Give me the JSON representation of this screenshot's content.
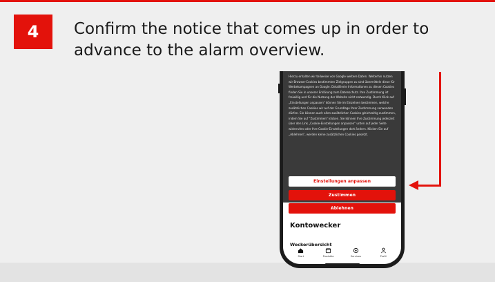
{
  "step": {
    "number": "4"
  },
  "instruction": "Confirm the notice that comes up in order to advance to the alarm overview.",
  "phone": {
    "cookie_text": "Hierzu erhalten wir teilweise von Google weitere Daten. Weiterhin nutzen wir Browser-Cookies bestimmten Zielgruppen zu sind übermitteln diese für Werbekampagnen an Google. Detaillierte Informationen zu diesen Cookies finden Sie in unserer Erklärung zum Datenschutz. Ihre Zustimmung ist freiwillig und für die Nutzung der Website nicht notwendig. Durch Klick auf „Einstellungen anpassen“ können Sie im Einzelnen bestimmen, welche zusätzlichen Cookies wir auf der Grundlage Ihrer Zustimmung verwenden dürfen. Sie können auch allen zusätzlichen Cookies gleichzeitig zustimmen, indem Sie auf “Zustimmen” klicken. Sie können Ihre Zustimmung jederzeit über den Link „Cookie-Einstellungen anpassen“ unten auf jeder Seite widerrufen oder Ihre Cookie-Einstellungen dort ändern. Klicken Sie auf „Ablehnen“, werden keine zusätzlichen Cookies gesetzt.",
    "buttons": {
      "customize": "Einstellungen anpassen",
      "accept": "Zustimmen",
      "decline": "Ablehnen"
    },
    "app_title": "Kontowecker",
    "section_title": "Weckerübersicht",
    "tabs": [
      {
        "label": "Start",
        "icon": "home-icon"
      },
      {
        "label": "Produkte",
        "icon": "wallet-icon"
      },
      {
        "label": "Services",
        "icon": "services-icon"
      },
      {
        "label": "Profil",
        "icon": "profile-icon"
      }
    ]
  },
  "colors": {
    "accent": "#e3120b",
    "background": "#efefef",
    "cookie_bg": "#3a3a3a"
  }
}
